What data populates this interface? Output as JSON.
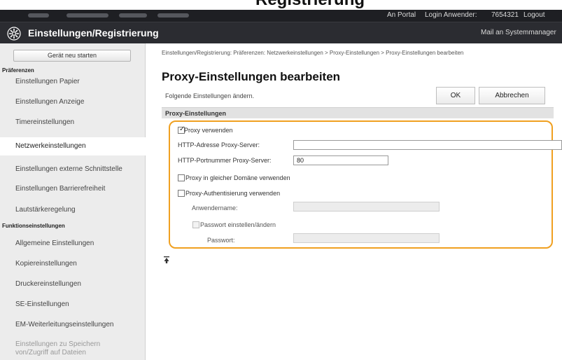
{
  "page_heading": "Registrierung",
  "topbar": {
    "links": [
      "An Portal",
      "Login Anwender:"
    ],
    "user_id": "7654321",
    "logout": "Logout"
  },
  "app": {
    "title": "Einstellungen/Registrierung",
    "mail_link": "Mail an Systemmanager"
  },
  "sidebar": {
    "restart_label": "Gerät neu starten",
    "sections": [
      {
        "title": "Präferenzen",
        "items": [
          "Einstellungen Papier",
          "Einstellungen Anzeige",
          "Timereinstellungen",
          "Netzwerkeinstellungen",
          "Einstellungen externe Schnittstelle",
          "Einstellungen Barrierefreiheit",
          "Lautstärkeregelung"
        ]
      },
      {
        "title": "Funktionseinstellungen",
        "items": [
          "Allgemeine Einstellungen",
          "Kopiereinstellungen",
          "Druckereinstellungen",
          "SE-Einstellungen",
          "EM-Weiterleitungseinstellungen",
          "Einstellungen zu Speichern von/Zugriff auf Dateien"
        ]
      }
    ],
    "active_item": "Netzwerkeinstellungen"
  },
  "breadcrumb": "Einstellungen/Registrierung: Präferenzen: Netzwerkeinstellungen > Proxy-Einstellungen > Proxy-Einstellungen bearbeiten",
  "page_title": "Proxy-Einstellungen bearbeiten",
  "hint": "Folgende Einstellungen ändern.",
  "buttons": {
    "ok": "OK",
    "cancel": "Abbrechen"
  },
  "section_title": "Proxy-Einstellungen",
  "form": {
    "use_proxy": {
      "label": "Proxy verwenden",
      "checked": true
    },
    "server_address": {
      "label": "HTTP-Adresse Proxy-Server:",
      "value": ""
    },
    "port": {
      "label": "HTTP-Portnummer Proxy-Server:",
      "value": "80"
    },
    "same_domain": {
      "label": "Proxy in gleicher Domäne verwenden",
      "checked": false
    },
    "auth": {
      "label": "Proxy-Authentisierung verwenden",
      "checked": false
    },
    "username": {
      "label": "Anwendername:",
      "value": ""
    },
    "set_password": {
      "label": "Passwort einstellen/ändern",
      "checked": false
    },
    "password": {
      "label": "Passwort:",
      "value": ""
    }
  },
  "colors": {
    "highlight": "#f0a020",
    "header_dark": "#1e1f23",
    "titlebar": "#2b2c31",
    "sidebar_bg": "#ececec"
  },
  "icons": {
    "app": "gear-icon",
    "back_to_top": "arrow-up-icon"
  }
}
